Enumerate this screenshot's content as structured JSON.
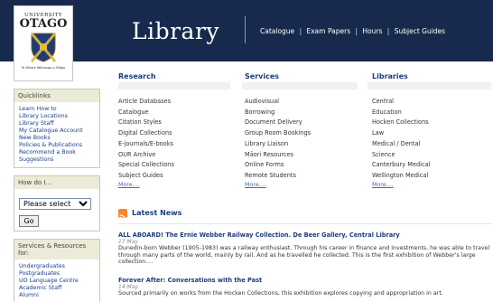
{
  "header": {
    "logo": {
      "line1": "UNIVERSITY",
      "line2": "OTAGO",
      "line3": "Te Whare Wānanga o Otāgo"
    },
    "title": "Library",
    "links": [
      "Catalogue",
      "Exam Papers",
      "Hours",
      "Subject Guides"
    ],
    "separator": "|"
  },
  "sidebar": {
    "quicklinks": {
      "heading": "Quicklinks",
      "items": [
        "Learn How to",
        "Library Locations",
        "Library Staff",
        "My Catalogue Account",
        "New Books",
        "Policies & Publications",
        "Recommend a Book",
        "Suggestions"
      ]
    },
    "howdo": {
      "heading": "How do I...",
      "select_value": "Please select",
      "go_label": "Go"
    },
    "services": {
      "heading": "Services & Resources for:",
      "items": [
        "Undergraduates",
        "Postgraduates",
        "UO Language Centre",
        "Academic Staff",
        "Alumni"
      ]
    }
  },
  "columns": [
    {
      "heading": "Research",
      "items": [
        "Article Databases",
        "Catalogue",
        "Citation Styles",
        "Digital Collections",
        "E-journals/E-books",
        "OUR Archive",
        "Special Collections",
        "Subject Guides"
      ],
      "more": "More...."
    },
    {
      "heading": "Services",
      "items": [
        "Audiovisual",
        "Borrowing",
        "Document Delivery",
        "Group Room Bookings",
        "Library Liaison",
        "Māori Resources",
        "Online Forms",
        "Remote Students"
      ],
      "more": "More...."
    },
    {
      "heading": "Libraries",
      "items": [
        "Central",
        "Education",
        "Hocken Collections",
        "Law",
        "Medical / Dental",
        "Science",
        "Canterbury Medical",
        "Wellington Medical"
      ],
      "more": "More...."
    }
  ],
  "news": {
    "heading": "Latest News",
    "items": [
      {
        "title": "ALL ABOARD! The Ernie Webber Railway Collection. De Beer Gallery, Central Library",
        "date": "17 May",
        "text": "Dunedin-born Webber (1905-1983) was a railway enthusiast. Through his career in finance and investments, he was able to travel through many parts of the world, mainly by rail. And as he travelled he collected. This is the first exhibition of Webber's large collection...."
      },
      {
        "title": "Forever After: Conversations with the Past",
        "date": "14 May",
        "text": "Sourced primarily on works from the Hocken Collections, this exhibition explores copying and appropriation in art."
      }
    ]
  },
  "colors": {
    "header_bg": "#172a4d",
    "link": "#1a3d8f",
    "heading": "#1d3d7a",
    "box_head_bg": "#ecebd7",
    "rss": "#f7872b"
  }
}
